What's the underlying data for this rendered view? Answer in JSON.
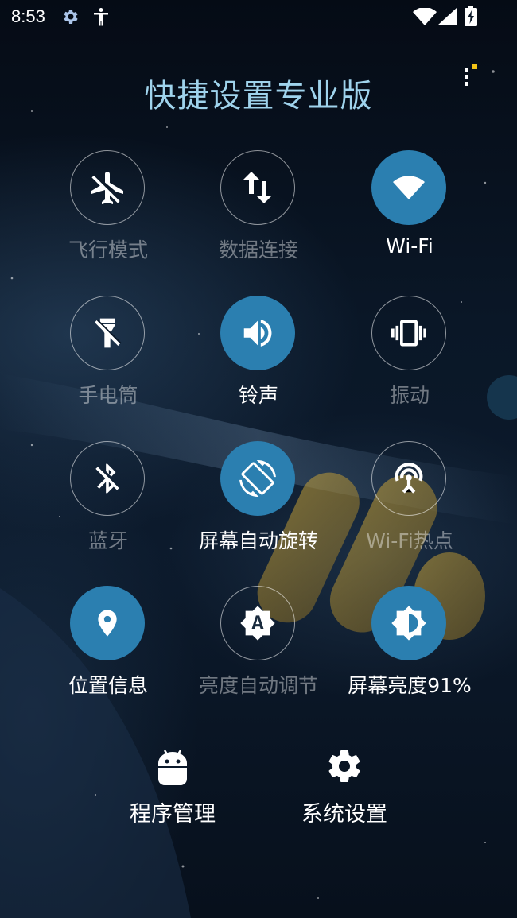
{
  "status_bar": {
    "time": "8:53",
    "icons": [
      "gear-icon",
      "accessibility-icon",
      "wifi-signal-icon",
      "cell-signal-icon",
      "battery-charging-icon"
    ]
  },
  "header": {
    "title": "快捷设置专业版",
    "menu_icon": "overflow-menu-icon"
  },
  "tiles": [
    {
      "label": "飞行模式",
      "icon": "airplane-off-icon",
      "active": false
    },
    {
      "label": "数据连接",
      "icon": "data-arrows-icon",
      "active": false
    },
    {
      "label": "Wi-Fi",
      "icon": "wifi-icon",
      "active": true
    },
    {
      "label": "手电筒",
      "icon": "flashlight-off-icon",
      "active": false
    },
    {
      "label": "铃声",
      "icon": "volume-icon",
      "active": true
    },
    {
      "label": "振动",
      "icon": "vibrate-icon",
      "active": false
    },
    {
      "label": "蓝牙",
      "icon": "bluetooth-off-icon",
      "active": false
    },
    {
      "label": "屏幕自动旋转",
      "icon": "rotate-screen-icon",
      "active": true
    },
    {
      "label": "Wi-Fi热点",
      "icon": "hotspot-icon",
      "active": false
    },
    {
      "label": "位置信息",
      "icon": "location-pin-icon",
      "active": true
    },
    {
      "label": "亮度自动调节",
      "icon": "auto-brightness-icon",
      "active": false
    },
    {
      "label": "屏幕亮度91%",
      "icon": "brightness-icon",
      "active": true
    }
  ],
  "bottom": {
    "apps_label": "程序管理",
    "apps_icon": "android-icon",
    "settings_label": "系统设置",
    "settings_icon": "gear-icon"
  },
  "colors": {
    "accent": "#2b7fb0",
    "title": "#9fd3ec",
    "inactive_text": "rgba(255,255,255,0.42)",
    "background": "#0a1727"
  }
}
